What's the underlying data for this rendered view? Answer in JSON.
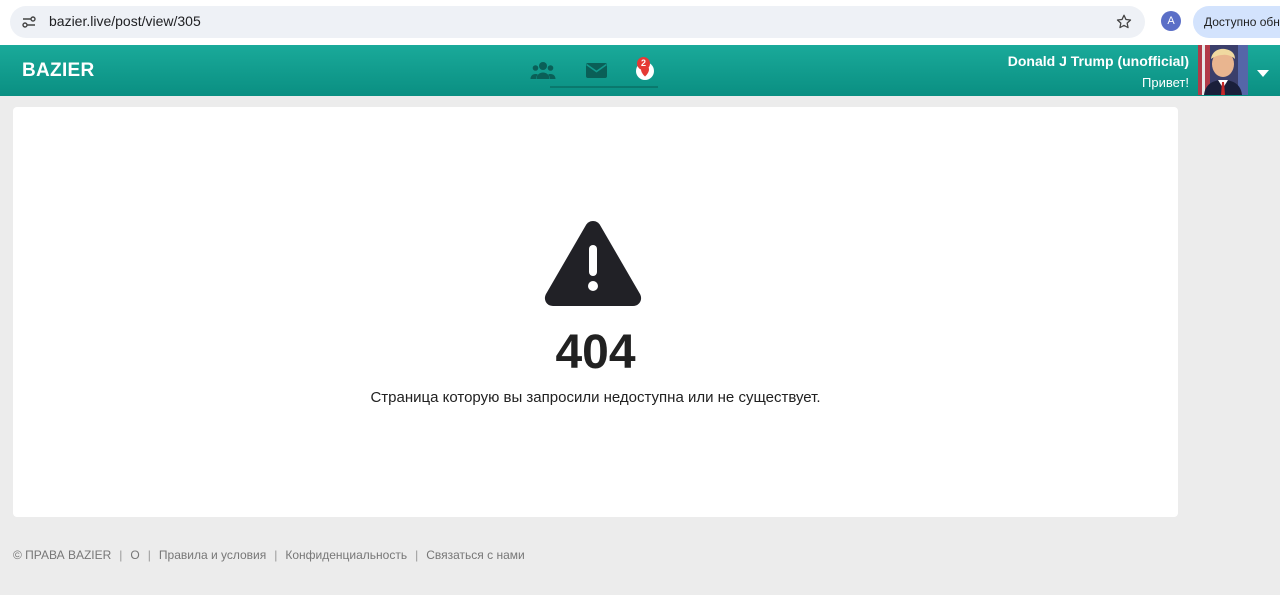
{
  "browser": {
    "url": "bazier.live/post/view/305",
    "profile_initial": "A",
    "update_chip": "Доступно обн"
  },
  "header": {
    "brand": "BAZIER",
    "notification_count": "2",
    "user_name": "Donald J Trump (unofficial)",
    "greeting": "Привет!",
    "icons": [
      "friends-icon",
      "messages-icon",
      "notifications-icon"
    ]
  },
  "error": {
    "code": "404",
    "message": "Страница которую вы запросили недоступна или не существует."
  },
  "footer": {
    "copyright": "© ПРАВА BAZIER",
    "sep": "|",
    "links": [
      "О",
      "Правила и условия",
      "Конфиденциальность",
      "Связаться с нами"
    ]
  },
  "colors": {
    "header_bg": "#119b8d",
    "page_bg": "#ececec",
    "text_dark": "#212121"
  }
}
